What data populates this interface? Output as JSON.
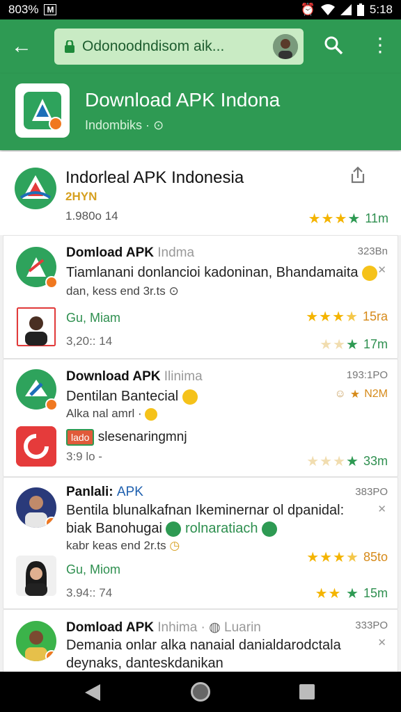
{
  "status": {
    "left": "803%",
    "box": "M",
    "time": "5:18"
  },
  "browser": {
    "url": "Odonoodndisom aik..."
  },
  "hero": {
    "title": "Download APK Indona",
    "subtitle": "Indombiks ·"
  },
  "header_card": {
    "title": "Indorleal APK Indonesia",
    "rank": "2HYN",
    "size": "1.980o 14",
    "rating": "11m"
  },
  "cards": [
    {
      "title": "Domload APK",
      "title_dim": "Indma",
      "time": "323Bn",
      "desc": "Tiamlanani donlancioi kadoninan, Bhandamaita",
      "sub": "dan, kess end 3r.ts",
      "author": "Gu, Miam",
      "date": "3,20:: 14",
      "rating1": "15ra",
      "rating2": "17m"
    },
    {
      "title": "Download APK",
      "title_dim": "Ilinima",
      "time": "193:1PO",
      "desc": "Dentilan Bantecial",
      "sub": "Alka nal amrl ·",
      "side": "N2M",
      "tag": "lado",
      "tag_text": "slesenaringmnj",
      "date": "3:9 lo -",
      "rating": "33m"
    },
    {
      "title": "Panlali:",
      "title_dim": "APK",
      "time": "383PO",
      "desc": "Bentila blunalkafnan Ikeminernar ol dpanidal:",
      "desc2": "biak Banohugai",
      "desc2b": "rolnaratiach",
      "sub": "kabr keas end 2r.ts",
      "author": "Gu, Miom",
      "date": "3.94:: 74",
      "rating1": "85to",
      "rating2": "15m"
    },
    {
      "title": "Domload APK",
      "title_dim": "Inhima ·",
      "title_dim2": "Luarin",
      "time": "333PO",
      "desc": "Demania onlar alka nanaial danialdarodctala",
      "desc2": "deynaks, danteskdanikan"
    }
  ],
  "colors": {
    "primary": "#2e9a53",
    "star": "#f4b400"
  }
}
